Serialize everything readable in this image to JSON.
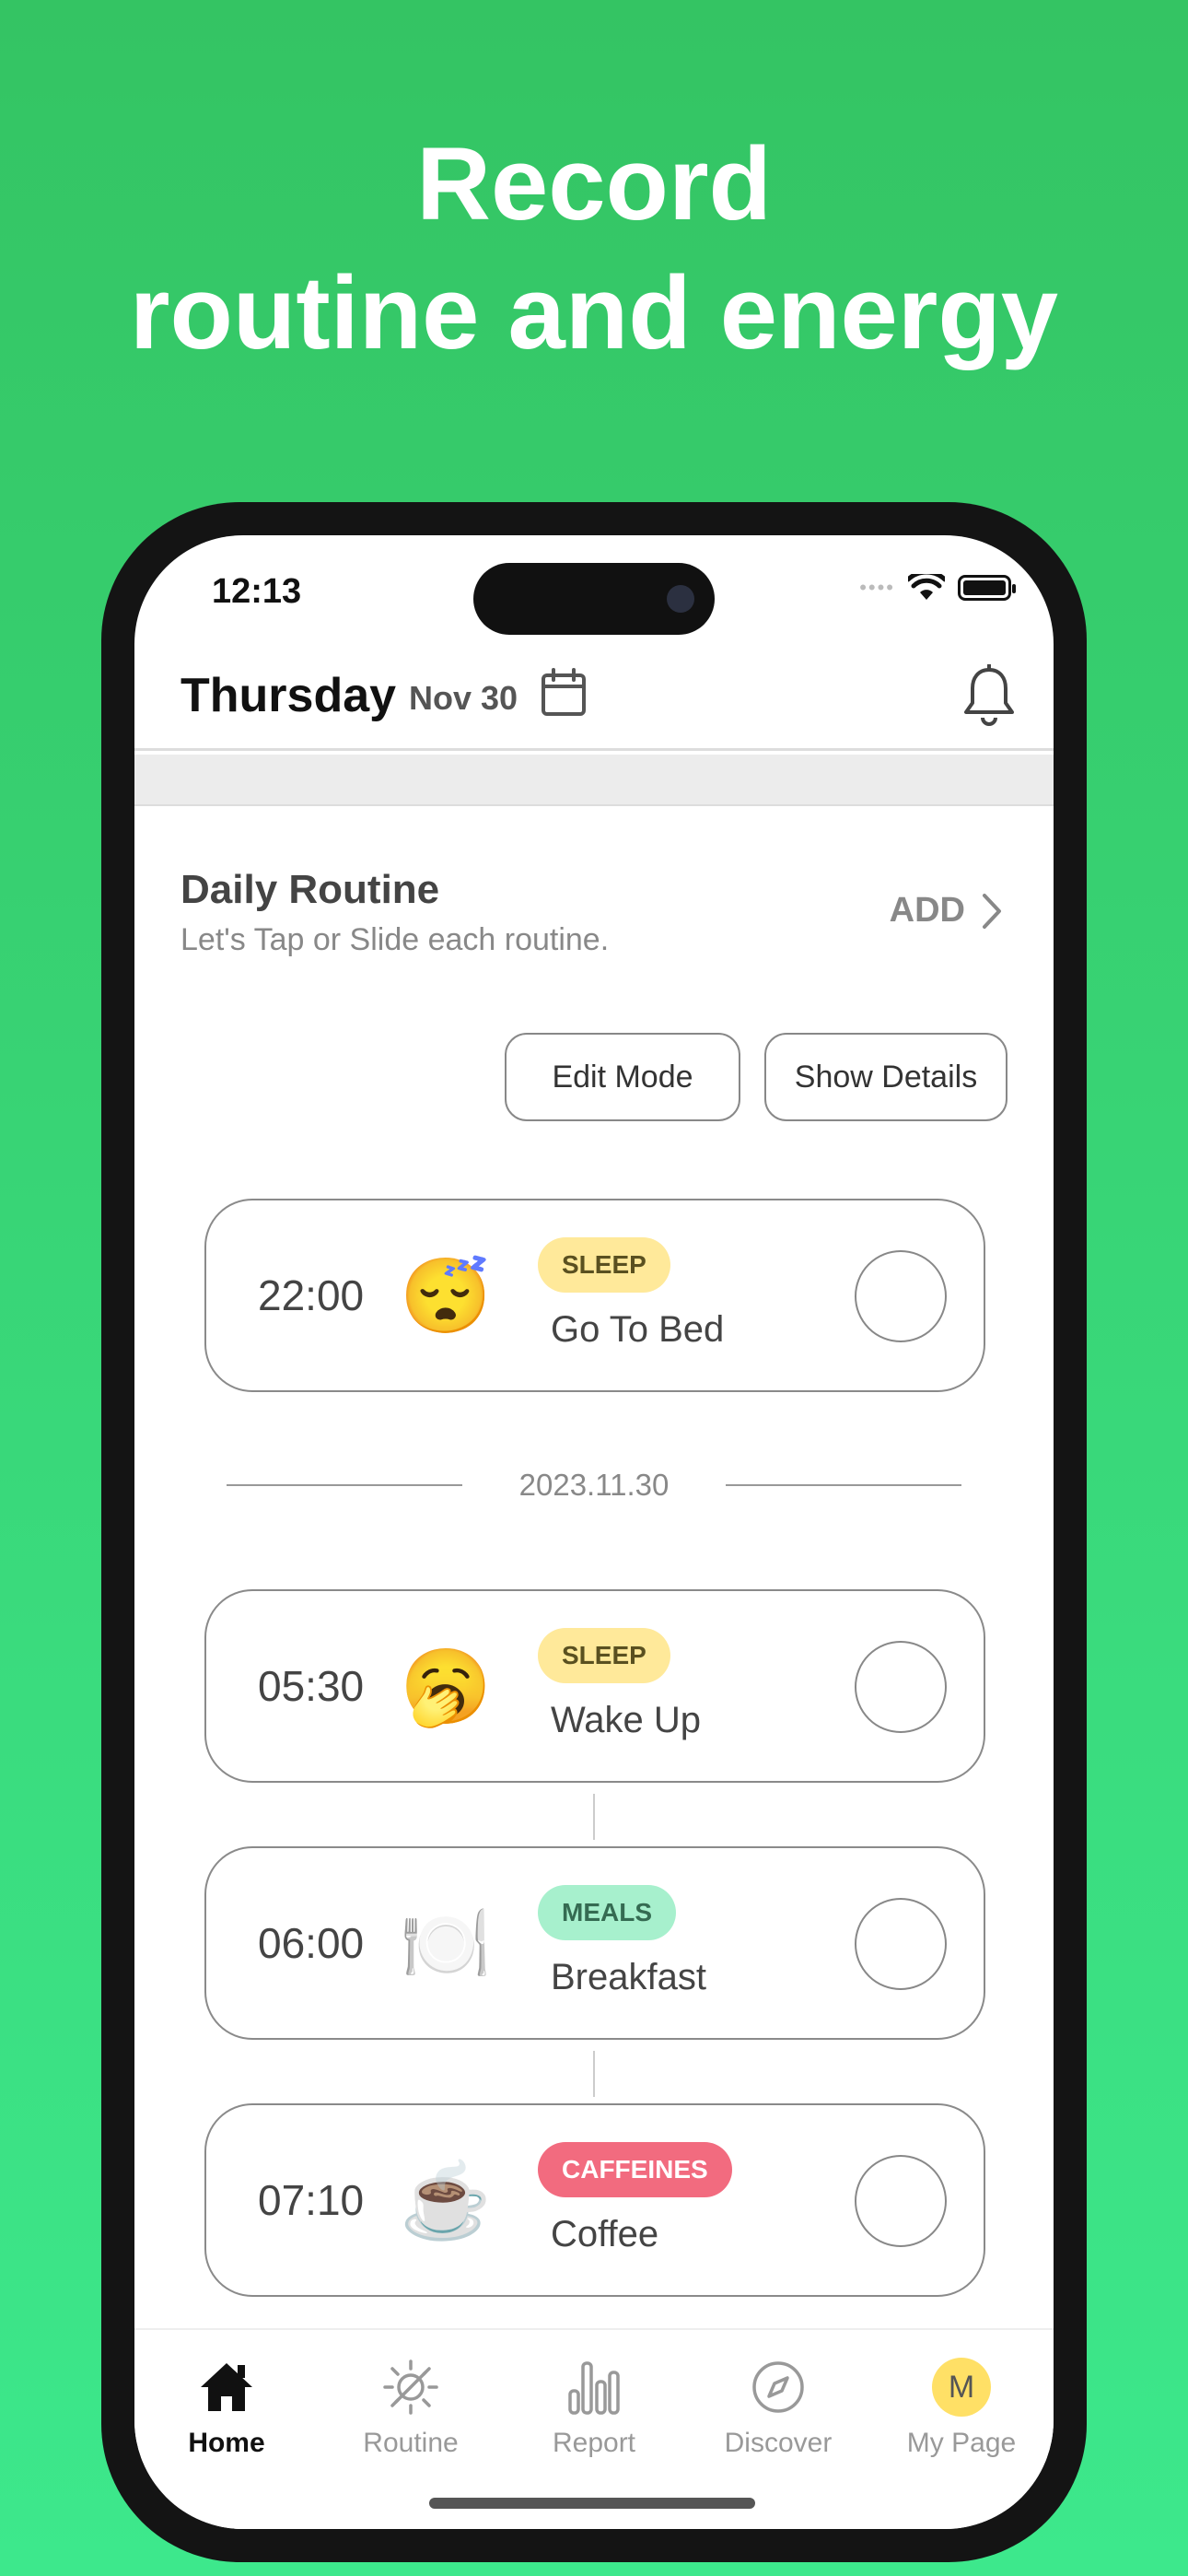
{
  "headline": {
    "line1": "Record",
    "line2": "routine and energy"
  },
  "status_bar": {
    "time": "12:13",
    "dots": "••••"
  },
  "header": {
    "day": "Thursday",
    "date": "Nov 30",
    "calendar_icon": "calendar-icon",
    "bell_icon": "bell-icon"
  },
  "routine_section": {
    "title": "Daily Routine",
    "subtitle": "Let's Tap or Slide each routine.",
    "add_label": "ADD",
    "edit_mode_label": "Edit Mode",
    "show_details_label": "Show Details"
  },
  "routines": [
    {
      "time": "22:00",
      "emoji": "😴",
      "tag": "SLEEP",
      "name": "Go To Bed"
    },
    {
      "time": "05:30",
      "emoji": "🥱",
      "tag": "SLEEP",
      "name": "Wake Up"
    },
    {
      "time": "06:00",
      "emoji": "🍽️",
      "tag": "MEALS",
      "name": "Breakfast"
    },
    {
      "time": "07:10",
      "emoji": "☕",
      "tag": "CAFFEINES",
      "name": "Coffee"
    }
  ],
  "date_divider": "2023.11.30",
  "tag_colors": {
    "SLEEP": "#ffe99a",
    "MEALS": "#a7f0cd",
    "CAFFEINES": "#f26b7f"
  },
  "tabbar": {
    "tabs": [
      {
        "label": "Home",
        "icon": "home-icon",
        "active": true
      },
      {
        "label": "Routine",
        "icon": "routine-icon"
      },
      {
        "label": "Report",
        "icon": "bar-chart-icon"
      },
      {
        "label": "Discover",
        "icon": "compass-icon"
      },
      {
        "label": "My Page",
        "icon": "avatar",
        "avatar_letter": "M"
      }
    ]
  }
}
